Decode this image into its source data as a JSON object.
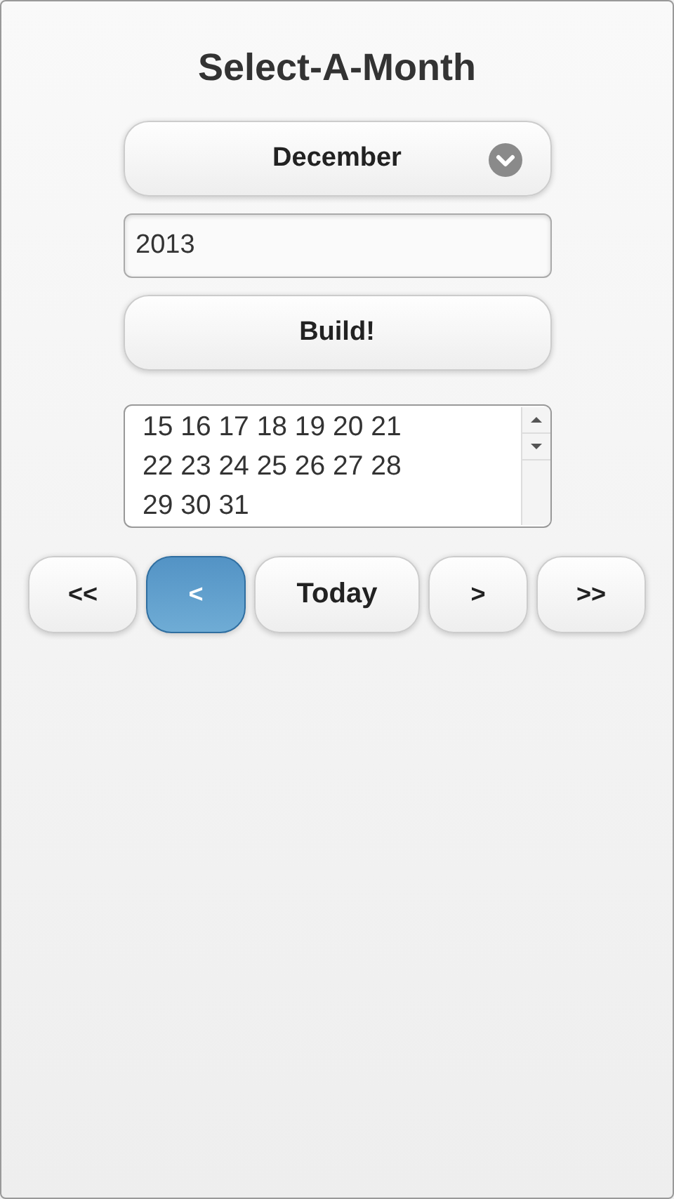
{
  "title": "Select-A-Month",
  "month_select": {
    "value": "December"
  },
  "year_field": {
    "value": "2013"
  },
  "build_button": {
    "label": "Build!"
  },
  "calendar_text": {
    "lines": [
      "15 16 17 18 19 20 21",
      "22 23 24 25 26 27 28",
      "29 30 31"
    ]
  },
  "nav_buttons": [
    {
      "label": "<<",
      "selected": false
    },
    {
      "label": "<",
      "selected": true
    },
    {
      "label": "Today",
      "selected": false
    },
    {
      "label": ">",
      "selected": false
    },
    {
      "label": ">>",
      "selected": false
    }
  ]
}
